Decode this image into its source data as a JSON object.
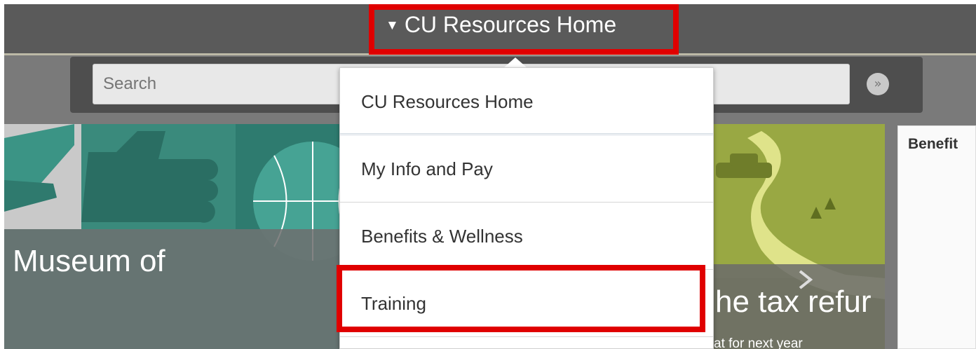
{
  "header": {
    "nav_title": "CU Resources Home",
    "caret": "▼"
  },
  "search": {
    "placeholder": "Search",
    "go_icon": "double-chevron-right-icon",
    "go_glyph": "»"
  },
  "tiles": [
    {
      "text": "Museum of"
    },
    {
      "text": "he tax refur",
      "subtitle": "at for next year"
    }
  ],
  "side_card": {
    "title": "Benefit"
  },
  "menu": {
    "items": [
      {
        "label": "CU Resources Home"
      },
      {
        "label": "My Info and Pay"
      },
      {
        "label": "Benefits & Wellness"
      },
      {
        "label": "Training"
      }
    ]
  },
  "colors": {
    "highlight": "#e00000",
    "teal": "#3e9a8b",
    "olive": "#9aa64a"
  }
}
